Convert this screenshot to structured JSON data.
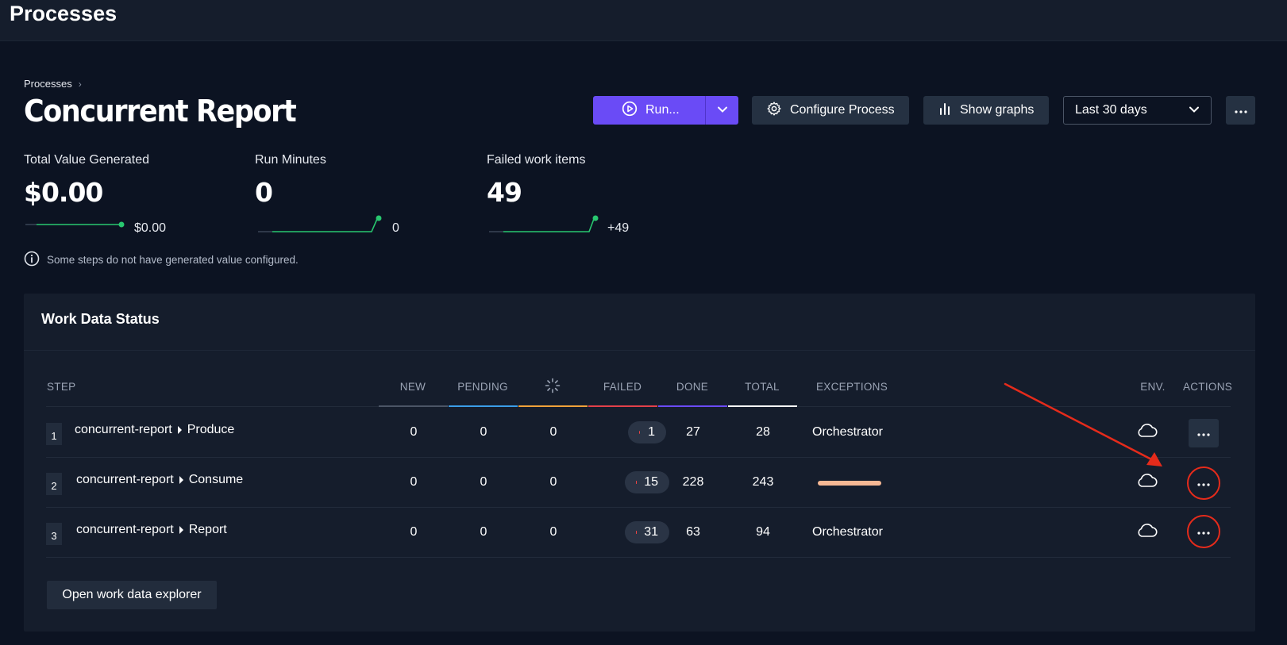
{
  "app": {
    "title": "Processes"
  },
  "breadcrumb": {
    "items": [
      "Processes"
    ]
  },
  "page": {
    "title": "Concurrent Report"
  },
  "toolbar": {
    "run_label": "Run...",
    "configure_label": "Configure Process",
    "graphs_label": "Show graphs",
    "range_value": "Last 30 days"
  },
  "metrics": [
    {
      "label": "Total Value Generated",
      "value": "$0.00",
      "trend_value": "$0.00"
    },
    {
      "label": "Run Minutes",
      "value": "0",
      "trend_value": "0"
    },
    {
      "label": "Failed work items",
      "value": "49",
      "trend_value": "+49"
    }
  ],
  "note": {
    "text": "Some steps do not have generated value configured."
  },
  "work_data": {
    "title": "Work Data Status",
    "columns": {
      "step": "STEP",
      "new": "NEW",
      "pending": "PENDING",
      "processing_icon": "spinner-icon",
      "failed": "FAILED",
      "done": "DONE",
      "total": "TOTAL",
      "exceptions": "EXCEPTIONS",
      "env": "ENV.",
      "actions": "ACTIONS"
    },
    "column_colors": {
      "new": "#4b5566",
      "pending": "#3b9ee8",
      "processing": "#f0a23a",
      "failed": "#e3404a",
      "done": "#6a4bf6",
      "total": "#ffffff"
    },
    "rows": [
      {
        "index": "1",
        "process": "concurrent-report",
        "step": "Produce",
        "new": "0",
        "pending": "0",
        "processing": "0",
        "failed": "1",
        "done": "27",
        "total": "28",
        "exceptions": "Orchestrator",
        "env_icon": "cloud-icon"
      },
      {
        "index": "2",
        "process": "concurrent-report",
        "step": "Consume",
        "new": "0",
        "pending": "0",
        "processing": "0",
        "failed": "15",
        "done": "228",
        "total": "243",
        "exceptions": "",
        "env_icon": "cloud-icon"
      },
      {
        "index": "3",
        "process": "concurrent-report",
        "step": "Report",
        "new": "0",
        "pending": "0",
        "processing": "0",
        "failed": "31",
        "done": "63",
        "total": "94",
        "exceptions": "Orchestrator",
        "env_icon": "cloud-icon"
      }
    ],
    "open_explorer_label": "Open work data explorer"
  }
}
